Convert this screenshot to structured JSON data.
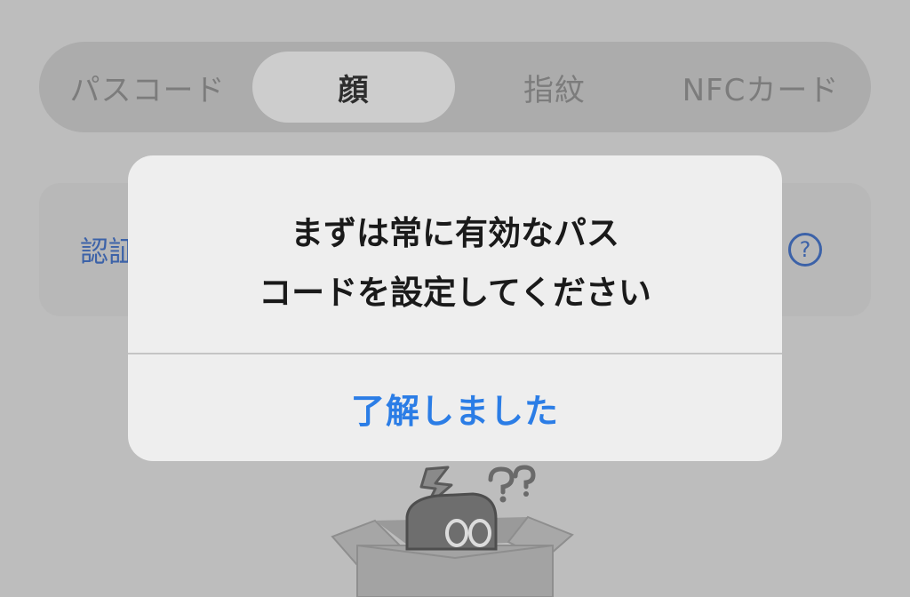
{
  "segmented_control": {
    "options": [
      "パスコード",
      "顔",
      "指紋",
      "NFCカード"
    ],
    "selected": "顔"
  },
  "background_card": {
    "label": "認証"
  },
  "help_icon": {
    "glyph": "?"
  },
  "alert": {
    "message_line_1": "まずは常に有効なパス",
    "message_line_2": "コードを設定してください",
    "button_label": "了解しました"
  },
  "colors": {
    "accent": "#2b7de6",
    "muted_link": "#3c62a8",
    "dim_background": "#bdbdbd",
    "alert_background": "#eeeeee"
  }
}
